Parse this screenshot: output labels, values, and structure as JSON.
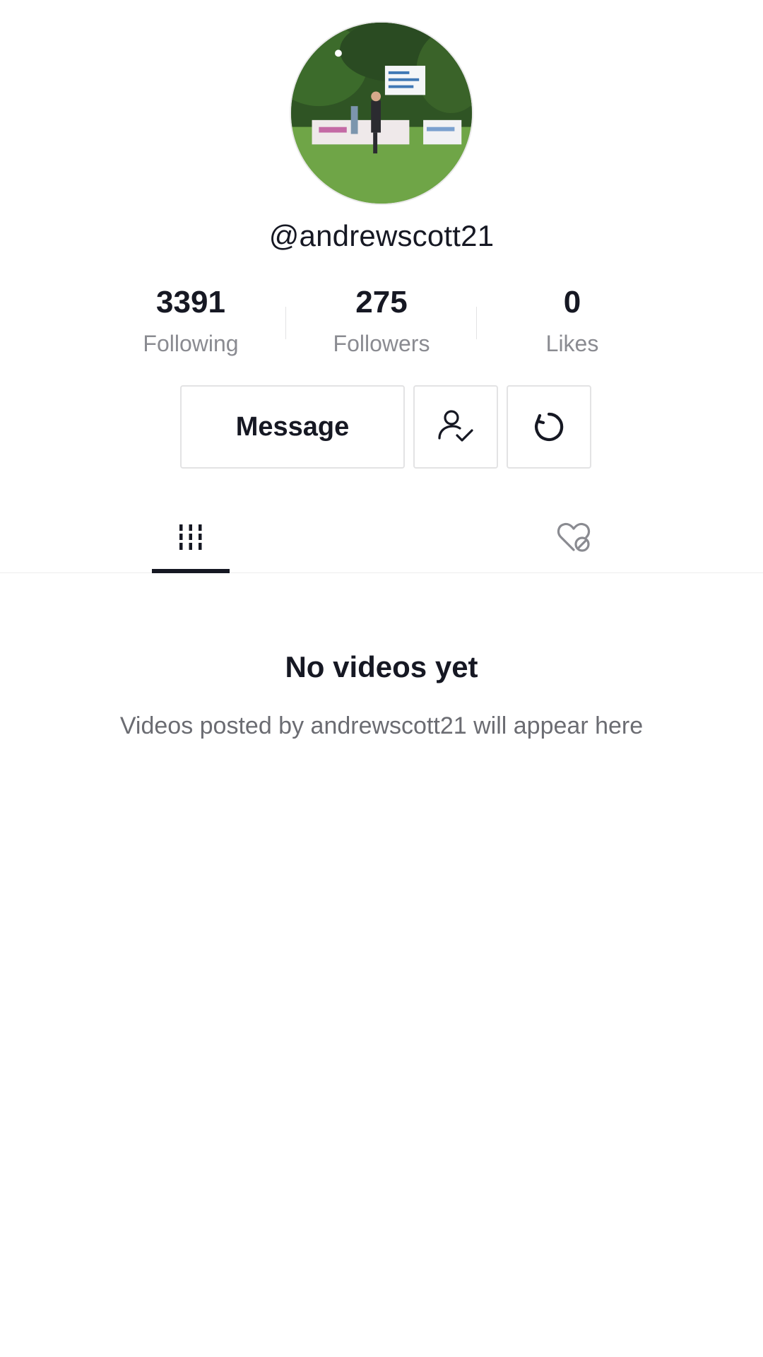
{
  "profile": {
    "username": "@andrewscott21"
  },
  "stats": {
    "following": {
      "value": "3391",
      "label": "Following"
    },
    "followers": {
      "value": "275",
      "label": "Followers"
    },
    "likes": {
      "value": "0",
      "label": "Likes"
    }
  },
  "actions": {
    "message_label": "Message",
    "follow_status_icon": "user-check-icon",
    "more_icon": "refresh-icon"
  },
  "tabs": [
    {
      "name": "videos",
      "icon": "grid-lines-icon",
      "active": true
    },
    {
      "name": "liked",
      "icon": "heart-hidden-icon",
      "active": false
    }
  ],
  "empty_state": {
    "title": "No videos yet",
    "subtitle": "Videos posted by andrewscott21 will appear here"
  },
  "colors": {
    "text": "#161823",
    "secondary_text": "#8a8b91",
    "border": "#e3e3e4"
  }
}
